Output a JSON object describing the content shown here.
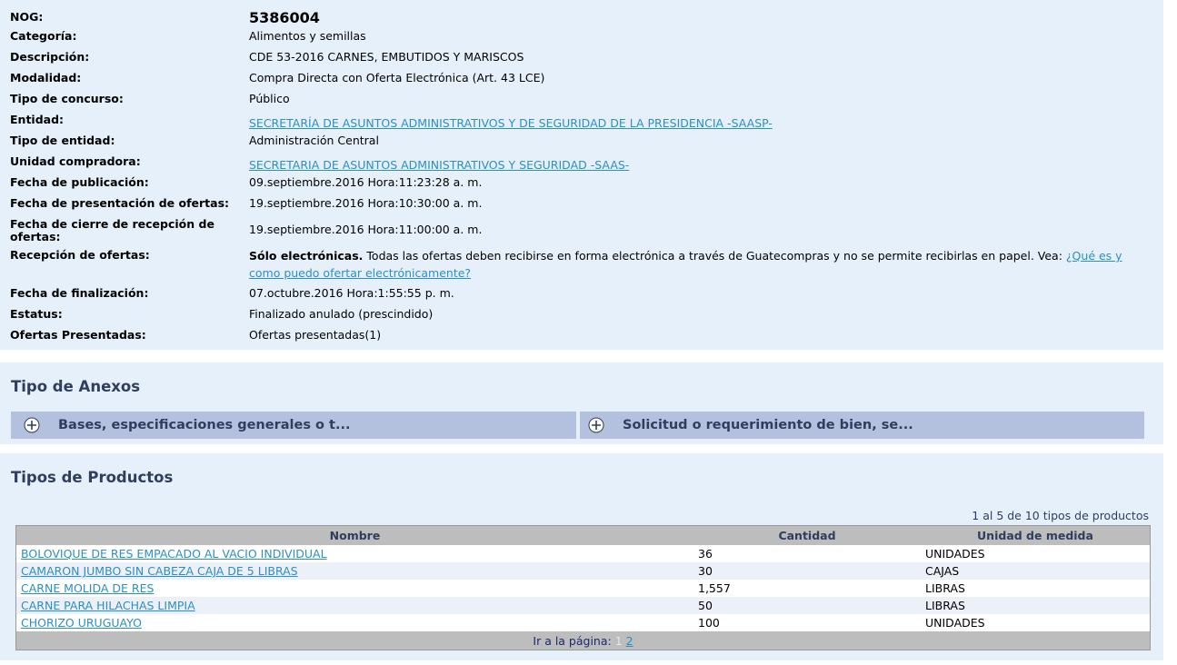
{
  "info": {
    "nog": {
      "label": "NOG:",
      "value": "5386004"
    },
    "categoria": {
      "label": "Categoría:",
      "value": "Alimentos y semillas"
    },
    "descripcion": {
      "label": "Descripción:",
      "value": "CDE 53-2016 CARNES, EMBUTIDOS Y MARISCOS"
    },
    "modalidad": {
      "label": "Modalidad:",
      "value": "Compra Directa con Oferta Electrónica (Art. 43 LCE)"
    },
    "tipo_concurso": {
      "label": "Tipo de concurso:",
      "value": "Público"
    },
    "entidad": {
      "label": "Entidad:",
      "value": "SECRETARÍA DE ASUNTOS ADMINISTRATIVOS Y DE SEGURIDAD DE LA PRESIDENCIA -SAASP-"
    },
    "tipo_entidad": {
      "label": "Tipo de entidad:",
      "value": "Administración Central"
    },
    "unidad_compradora": {
      "label": "Unidad compradora:",
      "value": "SECRETARIA DE ASUNTOS ADMINISTRATIVOS Y SEGURIDAD -SAAS-"
    },
    "fecha_publicacion": {
      "label": "Fecha de publicación:",
      "value": "09.septiembre.2016 Hora:11:23:28 a. m."
    },
    "fecha_presentacion": {
      "label": "Fecha de presentación de ofertas:",
      "value": "19.septiembre.2016 Hora:10:30:00 a. m."
    },
    "fecha_cierre": {
      "label": "Fecha de cierre de recepción de ofertas:",
      "value": "19.septiembre.2016 Hora:11:00:00 a. m."
    },
    "recepcion": {
      "label": "Recepción de ofertas:",
      "bold": "Sólo electrónicas.",
      "text": "Todas las ofertas deben recibirse en forma electrónica a través de Guatecompras y no se permite recibirlas en papel. Vea:",
      "link": "¿Qué es y como puedo ofertar electrónicamente?"
    },
    "fecha_finalizacion": {
      "label": "Fecha de finalización:",
      "value": "07.octubre.2016 Hora:1:55:55 p. m."
    },
    "estatus": {
      "label": "Estatus:",
      "value": "Finalizado anulado (prescindido)"
    },
    "ofertas": {
      "label": "Ofertas Presentadas:",
      "value": "Ofertas presentadas(1)"
    }
  },
  "anexos": {
    "title": "Tipo de Anexos",
    "items": [
      {
        "label": "Bases, especificaciones generales o t...",
        "icon": "plus-circle-icon"
      },
      {
        "label": "Solicitud o requerimiento de bien, se...",
        "icon": "plus-circle-icon"
      }
    ]
  },
  "productos": {
    "title": "Tipos de Productos",
    "count_text": "1 al 5 de 10 tipos de productos",
    "headers": [
      "Nombre",
      "Cantidad",
      "Unidad de medida"
    ],
    "rows": [
      {
        "nombre": "BOLOVIQUE DE RES EMPACADO AL VACIO INDIVIDUAL",
        "cantidad": "36",
        "unidad": "UNIDADES"
      },
      {
        "nombre": "CAMARON JUMBO SIN CABEZA CAJA DE 5 LIBRAS",
        "cantidad": "30",
        "unidad": "CAJAS"
      },
      {
        "nombre": "CARNE MOLIDA DE RES",
        "cantidad": "1,557",
        "unidad": "LIBRAS"
      },
      {
        "nombre": "CARNE PARA HILACHAS LIMPIA",
        "cantidad": "50",
        "unidad": "LIBRAS"
      },
      {
        "nombre": "CHORIZO URUGUAYO",
        "cantidad": "100",
        "unidad": "UNIDADES"
      }
    ],
    "pager": {
      "label": "Ir a la página:",
      "pages": [
        "1",
        "2"
      ],
      "current": "1"
    }
  },
  "colors": {
    "panel_bg": "#e6f0fa",
    "link": "#2a8fc7",
    "accordion_bg": "#b3c1df",
    "header_bg": "#bdbdbd",
    "title": "#2f3e5e"
  }
}
